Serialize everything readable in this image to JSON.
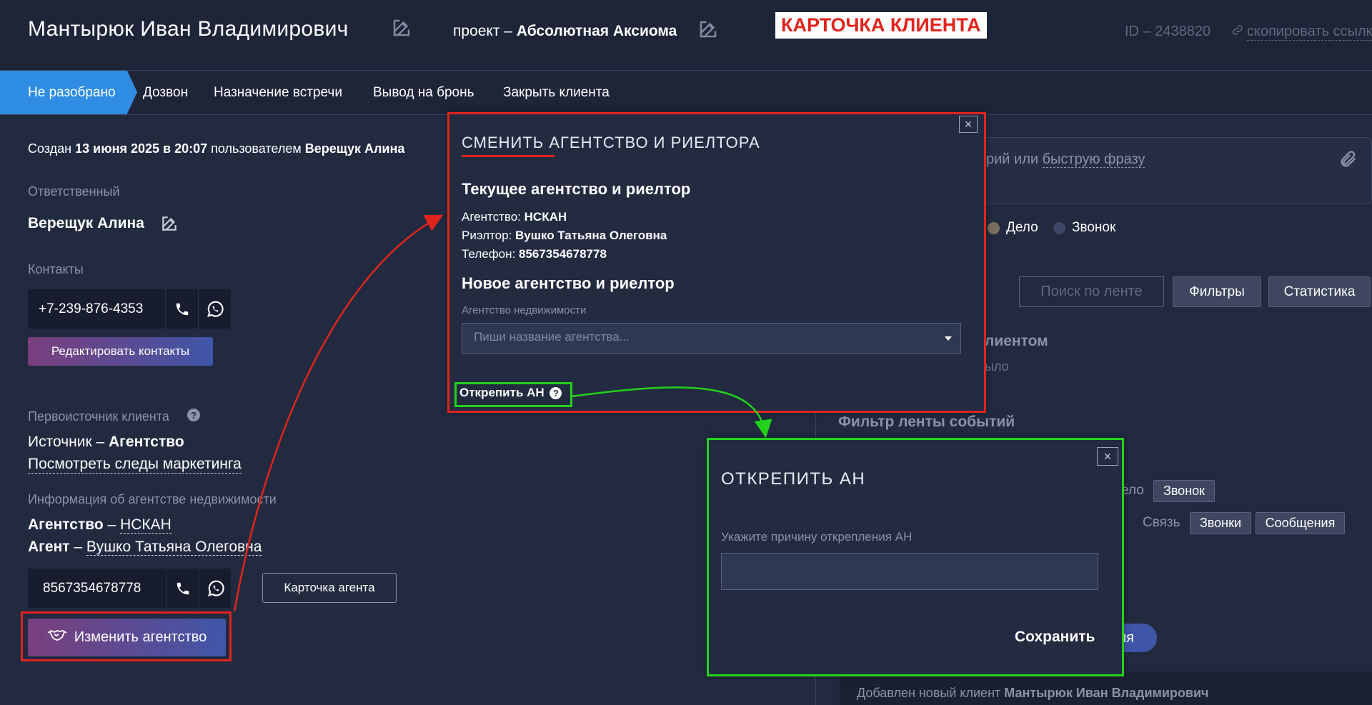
{
  "header": {
    "client_name": "Мантырюк Иван Владимирович",
    "project_prefix": "проект – ",
    "project_name": "Абсолютная Аксиома",
    "card_title": "КАРТОЧКА КЛИЕНТА",
    "client_id": "ID – 2438820",
    "copy_link": "скопировать ссылку"
  },
  "stages": [
    "Не разобрано",
    "Дозвон",
    "Назначение встречи",
    "Вывод на бронь",
    "Закрыть клиента"
  ],
  "left": {
    "created_prefix": "Создан ",
    "created_date": "13 июня 2025 в 20:07",
    "created_by_prefix": " пользователем ",
    "created_by": "Верещук Алина",
    "responsible_label": "Ответственный",
    "responsible_name": "Верещук Алина",
    "contacts_label": "Контакты",
    "phone": "+7-239-876-4353",
    "edit_contacts": "Редактировать контакты",
    "source_label": "Первоисточник клиента",
    "source_prefix": "Источник – ",
    "source_value": "Агентство",
    "marketing_link": "Посмотреть следы маркетинга",
    "agency_info_label": "Информация об агентстве недвижимости",
    "agency_prefix": "Агентство",
    "agency_dash": " – ",
    "agency_value": "НСКАН",
    "agent_prefix": "Агент",
    "agent_dash": " – ",
    "agent_value": "Вушко Татьяна Олеговна",
    "agent_phone": "8567354678778",
    "agent_card": "Карточка агента",
    "change_agency": "Изменить агентство"
  },
  "right": {
    "comment_placeholder_tail": "рий или ",
    "quick_phrase": "быструю фразу",
    "radio_task": "Дело",
    "radio_call": "Звонок",
    "feed_search_placeholder": "Поиск по ленте",
    "filters": "Фильтры",
    "statistics": "Статистика",
    "client_heading_tail": "лиентом",
    "was_tail": "ыло",
    "feed_filter_title": "Фильтр ленты событий",
    "tag_delo_tail": "ело",
    "tag_zvonok": "Звонок",
    "svyaz": "Связь",
    "tag_zvonki": "Звонки",
    "tag_soobscheniya": "Сообщения",
    "pill_tail": "ия",
    "event_prefix": "Добавлен новый клиент ",
    "event_client": "Мантырюк Иван Владимирович"
  },
  "modal_agency": {
    "title": "СМЕНИТЬ АГЕНТСТВО И РИЕЛТОРА",
    "current_heading": "Текущее агентство и риелтор",
    "agency_label": "Агентство: ",
    "agency_value": "НСКАН",
    "realtor_label": "Риэлтор: ",
    "realtor_value": "Вушко Татьяна Олеговна",
    "phone_label": "Телефон: ",
    "phone_value": "8567354678778",
    "new_heading": "Новое агентство и риелтор",
    "select_label": "Агентство недвижимости",
    "select_placeholder": "Пиши название агентства...",
    "unpin_link": "Открепить АН"
  },
  "modal_unpin": {
    "title": "ОТКРЕПИТЬ АН",
    "reason_label": "Укажите причину открепления АН",
    "save": "Сохранить"
  },
  "colors": {
    "accent_blue": "#2f8ee3",
    "highlight_red": "#e0241c",
    "highlight_green": "#23d21b",
    "background": "#222a40"
  }
}
